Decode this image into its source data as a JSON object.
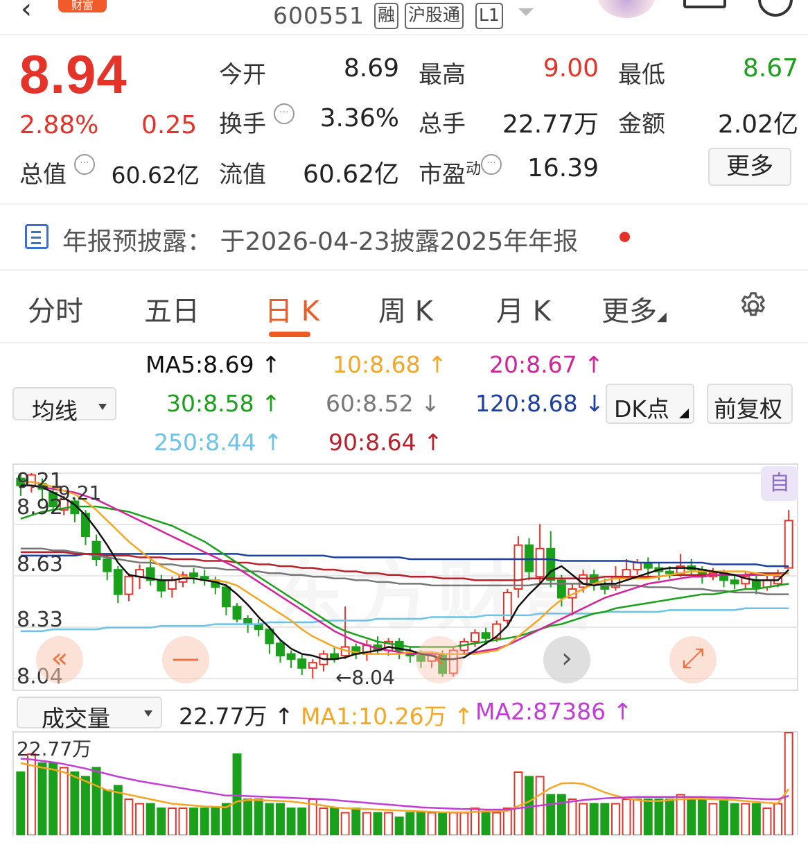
{
  "header": {
    "badge": "财富",
    "code": "600551",
    "tags": [
      "融",
      "沪股通",
      "L1"
    ]
  },
  "quote": {
    "price": "8.94",
    "change_pct": "2.88%",
    "change_val": "0.25",
    "open_label": "今开",
    "open": "8.69",
    "high_label": "最高",
    "high": "9.00",
    "low_label": "最低",
    "low": "8.67",
    "turnover_label": "换手",
    "turnover": "3.36%",
    "volume_label": "总手",
    "volume": "22.77万",
    "amount_label": "金额",
    "amount": "2.02亿",
    "mktcap_label": "总值",
    "mktcap": "60.62亿",
    "float_label": "流值",
    "float_cap": "60.62亿",
    "pe_label": "市盈",
    "pe_sup": "动",
    "pe": "16.39",
    "more_button": "更多"
  },
  "notice": {
    "text": "年报预披露： 于2026-04-23披露2025年年报"
  },
  "tabs": [
    "分时",
    "五日",
    "日 K",
    "周 K",
    "月 K",
    "更多"
  ],
  "active_tab": "日 K",
  "ma": {
    "selector": "均线",
    "ma5": "MA5:8.69 ↑",
    "ma10": "10:8.68 ↑",
    "ma20": "20:8.67 ↑",
    "ma30": "30:8.58 ↑",
    "ma60": "60:8.52 ↓",
    "ma120": "120:8.68 ↓",
    "ma250": "250:8.44 ↑",
    "ma90": "90:8.64 ↑",
    "dk_button": "DK点",
    "adjust_button": "前复权"
  },
  "colors": {
    "up": "#e5332a",
    "down": "#1aa01a",
    "ma5": "#111111",
    "ma10": "#f5a623",
    "ma20": "#d4239a",
    "ma30": "#1aa01a",
    "ma60": "#777777",
    "ma120": "#1c3fa0",
    "ma250": "#6cc3ea",
    "ma90": "#b8202a"
  },
  "chart": {
    "auto_badge": "自",
    "y_labels": [
      "9.21",
      "8.92",
      "8.63",
      "8.33",
      "8.04"
    ],
    "max_label": "9.21",
    "min_label": "←8.04",
    "controls": [
      "«",
      "—",
      "‹",
      "›",
      "⤢"
    ]
  },
  "volume": {
    "selector": "成交量",
    "current": "22.77万 ↑",
    "ma1": "MA1:10.26万 ↑",
    "ma2": "MA2:87386 ↑",
    "top_label": "22.77万"
  },
  "chart_data": {
    "type": "candlestick",
    "ylim": [
      8.04,
      9.21
    ],
    "candles": [
      [
        9.18,
        9.14,
        9.21,
        9.08
      ],
      [
        9.14,
        9.2,
        9.21,
        9.1
      ],
      [
        9.15,
        9.12,
        9.18,
        9.05
      ],
      [
        9.1,
        9.02,
        9.14,
        8.98
      ],
      [
        9.0,
        9.06,
        9.08,
        8.97
      ],
      [
        9.05,
        8.98,
        9.07,
        8.93
      ],
      [
        8.98,
        8.85,
        9.0,
        8.8
      ],
      [
        8.82,
        8.72,
        8.86,
        8.68
      ],
      [
        8.72,
        8.65,
        8.75,
        8.6
      ],
      [
        8.66,
        8.52,
        8.68,
        8.47
      ],
      [
        8.52,
        8.62,
        8.64,
        8.48
      ],
      [
        8.62,
        8.66,
        8.69,
        8.55
      ],
      [
        8.67,
        8.6,
        8.73,
        8.57
      ],
      [
        8.6,
        8.54,
        8.63,
        8.5
      ],
      [
        8.55,
        8.6,
        8.62,
        8.5
      ],
      [
        8.59,
        8.63,
        8.65,
        8.56
      ],
      [
        8.64,
        8.62,
        8.67,
        8.58
      ],
      [
        8.62,
        8.6,
        8.66,
        8.57
      ],
      [
        8.6,
        8.56,
        8.62,
        8.52
      ],
      [
        8.56,
        8.45,
        8.58,
        8.4
      ],
      [
        8.45,
        8.38,
        8.47,
        8.36
      ],
      [
        8.38,
        8.35,
        8.4,
        8.3
      ],
      [
        8.35,
        8.32,
        8.38,
        8.28
      ],
      [
        8.32,
        8.24,
        8.34,
        8.18
      ],
      [
        8.24,
        8.17,
        8.26,
        8.13
      ],
      [
        8.18,
        8.15,
        8.2,
        8.1
      ],
      [
        8.15,
        8.1,
        8.18,
        8.06
      ],
      [
        8.1,
        8.13,
        8.15,
        8.04
      ],
      [
        8.12,
        8.18,
        8.2,
        8.08
      ],
      [
        8.18,
        8.15,
        8.22,
        8.13
      ],
      [
        8.17,
        8.22,
        8.45,
        8.15
      ],
      [
        8.22,
        8.18,
        8.24,
        8.15
      ],
      [
        8.18,
        8.23,
        8.26,
        8.14
      ],
      [
        8.23,
        8.2,
        8.28,
        8.18
      ],
      [
        8.2,
        8.25,
        8.27,
        8.17
      ],
      [
        8.25,
        8.2,
        8.27,
        8.15
      ],
      [
        8.19,
        8.17,
        8.22,
        8.13
      ],
      [
        8.17,
        8.14,
        8.2,
        8.1
      ],
      [
        8.14,
        8.17,
        8.19,
        8.1
      ],
      [
        8.18,
        8.07,
        8.2,
        8.05
      ],
      [
        8.07,
        8.2,
        8.22,
        8.05
      ],
      [
        8.2,
        8.25,
        8.27,
        8.18
      ],
      [
        8.25,
        8.3,
        8.32,
        8.22
      ],
      [
        8.3,
        8.27,
        8.33,
        8.23
      ],
      [
        8.27,
        8.35,
        8.37,
        8.25
      ],
      [
        8.37,
        8.53,
        8.55,
        8.35
      ],
      [
        8.55,
        8.8,
        8.85,
        8.5
      ],
      [
        8.8,
        8.65,
        8.84,
        8.6
      ],
      [
        8.62,
        8.78,
        8.92,
        8.58
      ],
      [
        8.78,
        8.6,
        8.88,
        8.56
      ],
      [
        8.6,
        8.5,
        8.63,
        8.45
      ],
      [
        8.5,
        8.55,
        8.58,
        8.4
      ],
      [
        8.56,
        8.63,
        8.66,
        8.53
      ],
      [
        8.63,
        8.58,
        8.66,
        8.54
      ],
      [
        8.58,
        8.55,
        8.61,
        8.52
      ],
      [
        8.56,
        8.62,
        8.68,
        8.54
      ],
      [
        8.62,
        8.66,
        8.72,
        8.6
      ],
      [
        8.66,
        8.7,
        8.72,
        8.63
      ],
      [
        8.7,
        8.67,
        8.73,
        8.62
      ],
      [
        8.67,
        8.65,
        8.7,
        8.6
      ],
      [
        8.65,
        8.64,
        8.68,
        8.61
      ],
      [
        8.64,
        8.68,
        8.75,
        8.62
      ],
      [
        8.68,
        8.66,
        8.72,
        8.62
      ],
      [
        8.66,
        8.62,
        8.68,
        8.58
      ],
      [
        8.62,
        8.64,
        8.67,
        8.6
      ],
      [
        8.64,
        8.6,
        8.66,
        8.56
      ],
      [
        8.6,
        8.58,
        8.63,
        8.55
      ],
      [
        8.58,
        8.62,
        8.65,
        8.55
      ],
      [
        8.6,
        8.56,
        8.63,
        8.52
      ],
      [
        8.56,
        8.6,
        8.63,
        8.54
      ],
      [
        8.58,
        8.62,
        8.66,
        8.56
      ],
      [
        8.67,
        8.94,
        9.0,
        8.67
      ]
    ],
    "volumes": [
      14,
      18,
      16,
      16,
      15,
      14,
      13,
      15,
      10,
      11,
      8,
      7,
      7,
      6,
      6,
      6,
      6,
      6,
      6,
      7,
      18,
      8,
      8,
      7,
      7,
      6,
      6,
      8,
      6,
      6,
      5,
      6,
      5,
      5,
      5,
      4,
      5,
      5,
      5,
      5,
      5,
      5,
      6,
      5,
      5,
      6,
      14,
      13,
      13,
      9,
      9,
      8,
      7,
      7,
      7,
      7,
      8,
      8,
      8,
      8,
      8,
      9,
      8,
      8,
      7,
      8,
      7,
      7,
      7,
      6,
      7,
      22.77
    ],
    "ma_lines": {
      "ma5": [
        9.14,
        9.14,
        9.13,
        9.1,
        9.07,
        9.03,
        8.97,
        8.89,
        8.8,
        8.7,
        8.63,
        8.62,
        8.61,
        8.6,
        8.6,
        8.61,
        8.61,
        8.6,
        8.59,
        8.57,
        8.52,
        8.46,
        8.39,
        8.33,
        8.26,
        8.21,
        8.18,
        8.17,
        8.15,
        8.15,
        8.16,
        8.18,
        8.19,
        8.2,
        8.22,
        8.21,
        8.2,
        8.18,
        8.17,
        8.15,
        8.15,
        8.16,
        8.2,
        8.24,
        8.28,
        8.34,
        8.45,
        8.52,
        8.58,
        8.65,
        8.68,
        8.63,
        8.58,
        8.57,
        8.58,
        8.58,
        8.6,
        8.62,
        8.64,
        8.66,
        8.67,
        8.67,
        8.67,
        8.66,
        8.65,
        8.64,
        8.63,
        8.61,
        8.6,
        8.6,
        8.6,
        8.66
      ],
      "ma10": [
        9.16,
        9.16,
        9.15,
        9.13,
        9.11,
        9.09,
        9.05,
        9.0,
        8.94,
        8.88,
        8.82,
        8.77,
        8.72,
        8.68,
        8.65,
        8.62,
        8.61,
        8.6,
        8.6,
        8.59,
        8.57,
        8.53,
        8.49,
        8.45,
        8.41,
        8.37,
        8.32,
        8.28,
        8.25,
        8.22,
        8.2,
        8.19,
        8.18,
        8.18,
        8.18,
        8.18,
        8.19,
        8.19,
        8.19,
        8.18,
        8.18,
        8.18,
        8.18,
        8.19,
        8.2,
        8.23,
        8.28,
        8.33,
        8.38,
        8.44,
        8.49,
        8.52,
        8.55,
        8.58,
        8.6,
        8.61,
        8.61,
        8.61,
        8.61,
        8.62,
        8.63,
        8.64,
        8.65,
        8.65,
        8.65,
        8.65,
        8.65,
        8.65,
        8.64,
        8.63,
        8.63,
        8.64
      ],
      "ma20": [
        9.14,
        9.14,
        9.13,
        9.12,
        9.11,
        9.1,
        9.08,
        9.06,
        9.03,
        9.0,
        8.97,
        8.94,
        8.91,
        8.88,
        8.85,
        8.82,
        8.79,
        8.76,
        8.73,
        8.7,
        8.67,
        8.63,
        8.59,
        8.55,
        8.51,
        8.47,
        8.43,
        8.39,
        8.35,
        8.31,
        8.28,
        8.25,
        8.23,
        8.21,
        8.2,
        8.19,
        8.18,
        8.18,
        8.18,
        8.18,
        8.18,
        8.18,
        8.19,
        8.2,
        8.21,
        8.23,
        8.26,
        8.29,
        8.32,
        8.35,
        8.38,
        8.41,
        8.44,
        8.47,
        8.5,
        8.52,
        8.54,
        8.56,
        8.58,
        8.59,
        8.6,
        8.61,
        8.62,
        8.62,
        8.63,
        8.63,
        8.63,
        8.63,
        8.63,
        8.63,
        8.63,
        8.64
      ],
      "ma30": [
        8.95,
        8.97,
        8.99,
        9.0,
        9.01,
        9.02,
        9.02,
        9.02,
        9.01,
        9.0,
        8.99,
        8.97,
        8.95,
        8.93,
        8.91,
        8.88,
        8.85,
        8.82,
        8.78,
        8.74,
        8.7,
        8.66,
        8.62,
        8.58,
        8.54,
        8.5,
        8.46,
        8.42,
        8.38,
        8.34,
        8.31,
        8.29,
        8.27,
        8.25,
        8.24,
        8.23,
        8.22,
        8.22,
        8.22,
        8.22,
        8.22,
        8.23,
        8.24,
        8.25,
        8.26,
        8.27,
        8.28,
        8.3,
        8.32,
        8.34,
        8.35,
        8.37,
        8.39,
        8.41,
        8.42,
        8.44,
        8.45,
        8.46,
        8.47,
        8.48,
        8.49,
        8.5,
        8.51,
        8.52,
        8.52,
        8.53,
        8.54,
        8.55,
        8.55,
        8.56,
        8.57,
        8.58
      ],
      "ma60": [
        8.78,
        8.78,
        8.78,
        8.77,
        8.77,
        8.76,
        8.75,
        8.74,
        8.73,
        8.72,
        8.71,
        8.7,
        8.7,
        8.69,
        8.69,
        8.68,
        8.68,
        8.67,
        8.67,
        8.66,
        8.66,
        8.65,
        8.65,
        8.64,
        8.64,
        8.63,
        8.63,
        8.62,
        8.62,
        8.61,
        8.61,
        8.6,
        8.6,
        8.59,
        8.59,
        8.58,
        8.58,
        8.58,
        8.57,
        8.57,
        8.57,
        8.57,
        8.57,
        8.57,
        8.57,
        8.57,
        8.57,
        8.57,
        8.58,
        8.58,
        8.58,
        8.58,
        8.58,
        8.58,
        8.57,
        8.57,
        8.57,
        8.57,
        8.56,
        8.56,
        8.56,
        8.55,
        8.55,
        8.55,
        8.54,
        8.54,
        8.53,
        8.53,
        8.53,
        8.52,
        8.52,
        8.52
      ],
      "ma90": [
        8.76,
        8.76,
        8.76,
        8.76,
        8.76,
        8.75,
        8.75,
        8.75,
        8.74,
        8.74,
        8.74,
        8.73,
        8.73,
        8.73,
        8.72,
        8.72,
        8.72,
        8.71,
        8.71,
        8.71,
        8.7,
        8.7,
        8.69,
        8.69,
        8.68,
        8.68,
        8.67,
        8.67,
        8.66,
        8.66,
        8.65,
        8.65,
        8.64,
        8.64,
        8.63,
        8.63,
        8.62,
        8.62,
        8.62,
        8.61,
        8.61,
        8.61,
        8.6,
        8.6,
        8.6,
        8.6,
        8.6,
        8.61,
        8.61,
        8.61,
        8.61,
        8.61,
        8.61,
        8.61,
        8.62,
        8.62,
        8.62,
        8.62,
        8.62,
        8.62,
        8.63,
        8.63,
        8.63,
        8.63,
        8.63,
        8.63,
        8.63,
        8.63,
        8.64,
        8.64,
        8.64,
        8.64
      ],
      "ma120": [
        8.74,
        8.74,
        8.74,
        8.74,
        8.74,
        8.74,
        8.75,
        8.75,
        8.75,
        8.75,
        8.75,
        8.75,
        8.75,
        8.75,
        8.75,
        8.75,
        8.75,
        8.75,
        8.75,
        8.75,
        8.75,
        8.74,
        8.74,
        8.74,
        8.74,
        8.74,
        8.74,
        8.74,
        8.74,
        8.73,
        8.73,
        8.73,
        8.73,
        8.73,
        8.73,
        8.73,
        8.72,
        8.72,
        8.72,
        8.72,
        8.72,
        8.72,
        8.72,
        8.72,
        8.72,
        8.72,
        8.72,
        8.72,
        8.72,
        8.72,
        8.71,
        8.71,
        8.71,
        8.71,
        8.71,
        8.71,
        8.71,
        8.7,
        8.7,
        8.7,
        8.7,
        8.7,
        8.7,
        8.7,
        8.69,
        8.69,
        8.69,
        8.69,
        8.69,
        8.68,
        8.68,
        8.68
      ],
      "ma250": [
        8.31,
        8.31,
        8.31,
        8.32,
        8.32,
        8.32,
        8.32,
        8.32,
        8.33,
        8.33,
        8.33,
        8.33,
        8.33,
        8.34,
        8.34,
        8.34,
        8.34,
        8.34,
        8.35,
        8.35,
        8.35,
        8.35,
        8.35,
        8.36,
        8.36,
        8.36,
        8.36,
        8.36,
        8.37,
        8.37,
        8.37,
        8.37,
        8.37,
        8.38,
        8.38,
        8.38,
        8.38,
        8.38,
        8.39,
        8.39,
        8.39,
        8.39,
        8.39,
        8.4,
        8.4,
        8.4,
        8.4,
        8.4,
        8.41,
        8.41,
        8.41,
        8.41,
        8.41,
        8.41,
        8.42,
        8.42,
        8.42,
        8.42,
        8.42,
        8.42,
        8.43,
        8.43,
        8.43,
        8.43,
        8.43,
        8.43,
        8.43,
        8.44,
        8.44,
        8.44,
        8.44,
        8.44
      ]
    },
    "vol_ma1": [
      16,
      15.5,
      15,
      14.6,
      14,
      13,
      12,
      11,
      10,
      9.5,
      9,
      8.5,
      8,
      7.5,
      7,
      6.8,
      6.6,
      6.4,
      6.3,
      6.2,
      7.5,
      7.8,
      7.8,
      7.7,
      7.6,
      7.5,
      7.2,
      6.9,
      6.6,
      6.2,
      6.0,
      5.9,
      5.8,
      5.7,
      5.6,
      5.5,
      5.4,
      5.3,
      5.2,
      5.1,
      5.1,
      5.1,
      5.2,
      5.3,
      5.3,
      5.4,
      6.5,
      7.5,
      9.0,
      10.5,
      11.5,
      11.6,
      11.4,
      10.5,
      9.5,
      8.8,
      8.2,
      7.8,
      7.6,
      7.6,
      7.8,
      8.0,
      8.1,
      8.1,
      8.0,
      7.9,
      7.8,
      7.6,
      7.4,
      7.2,
      7.1,
      10.26
    ],
    "vol_ma2": [
      17,
      16.8,
      16.5,
      16.2,
      15.8,
      15.3,
      14.8,
      14.2,
      13.6,
      13,
      12.5,
      12,
      11.6,
      11.2,
      10.8,
      10.4,
      10,
      9.6,
      9.2,
      8.8,
      8.8,
      8.7,
      8.6,
      8.5,
      8.4,
      8.3,
      8.2,
      8.1,
      8.0,
      7.8,
      7.6,
      7.4,
      7.2,
      7.0,
      6.8,
      6.6,
      6.4,
      6.2,
      6.1,
      6.0,
      5.9,
      5.8,
      5.8,
      5.7,
      5.7,
      5.7,
      6.0,
      6.3,
      6.6,
      6.9,
      7.2,
      7.5,
      7.8,
      8.0,
      8.2,
      8.3,
      8.4,
      8.5,
      8.5,
      8.5,
      8.5,
      8.5,
      8.5,
      8.5,
      8.4,
      8.4,
      8.3,
      8.2,
      8.1,
      8.0,
      8.0,
      8.74
    ]
  }
}
